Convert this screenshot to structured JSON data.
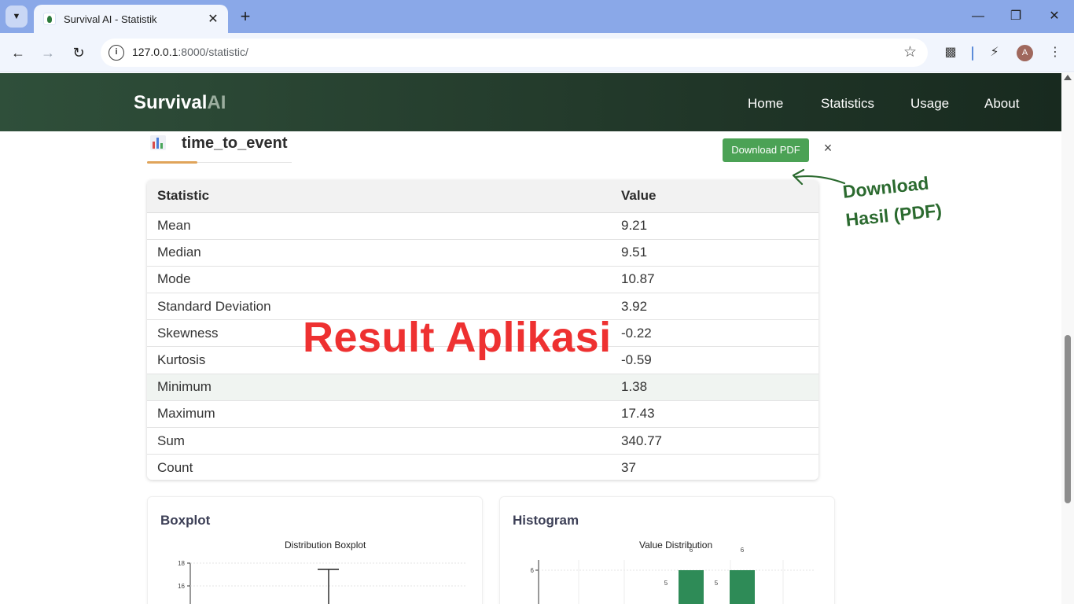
{
  "browser": {
    "tab_title": "Survival AI - Statistik",
    "url_host": "127.0.0.1",
    "url_path": ":8000/statistic/",
    "avatar_letter": "A"
  },
  "site": {
    "brand_main": "Survival",
    "brand_suffix": "AI",
    "nav": [
      "Home",
      "Statistics",
      "Usage",
      "About"
    ]
  },
  "variable": {
    "name": "time_to_event"
  },
  "actions": {
    "download_pdf": "Download PDF",
    "close": "×"
  },
  "stats_table": {
    "headers": [
      "Statistic",
      "Value"
    ],
    "rows": [
      {
        "label": "Mean",
        "value": "9.21"
      },
      {
        "label": "Median",
        "value": "9.51"
      },
      {
        "label": "Mode",
        "value": "10.87"
      },
      {
        "label": "Standard Deviation",
        "value": "3.92"
      },
      {
        "label": "Skewness",
        "value": "-0.22"
      },
      {
        "label": "Kurtosis",
        "value": "-0.59"
      },
      {
        "label": "Minimum",
        "value": "1.38"
      },
      {
        "label": "Maximum",
        "value": "17.43"
      },
      {
        "label": "Sum",
        "value": "340.77"
      },
      {
        "label": "Count",
        "value": "37"
      }
    ]
  },
  "overlay": {
    "watermark": "Result Aplikasi",
    "annotation_line1": "Download",
    "annotation_line2": "Hasil (PDF)"
  },
  "charts": {
    "boxplot": {
      "card_title": "Boxplot",
      "title": "Distribution Boxplot",
      "y_ticks": [
        "18",
        "16"
      ]
    },
    "histogram": {
      "card_title": "Histogram",
      "title": "Value Distribution",
      "y_tick": "6"
    }
  },
  "chart_data": [
    {
      "type": "box",
      "title": "Distribution Boxplot",
      "ylim": [
        14,
        18.5
      ],
      "max_whisker": 17.43,
      "visible_y_ticks": [
        16,
        18
      ]
    },
    {
      "type": "bar",
      "title": "Value Distribution",
      "visible_bars": [
        {
          "label_left": 5,
          "value": 6
        },
        {
          "label_left": 5,
          "value": 6
        }
      ],
      "visible_y_ticks": [
        6
      ]
    }
  ],
  "colors": {
    "navbar": "#233a2b",
    "button": "#4ba255",
    "watermark": "#ee3131",
    "annotation": "#2b6a2f",
    "histogram_bar": "#2e8b57"
  }
}
